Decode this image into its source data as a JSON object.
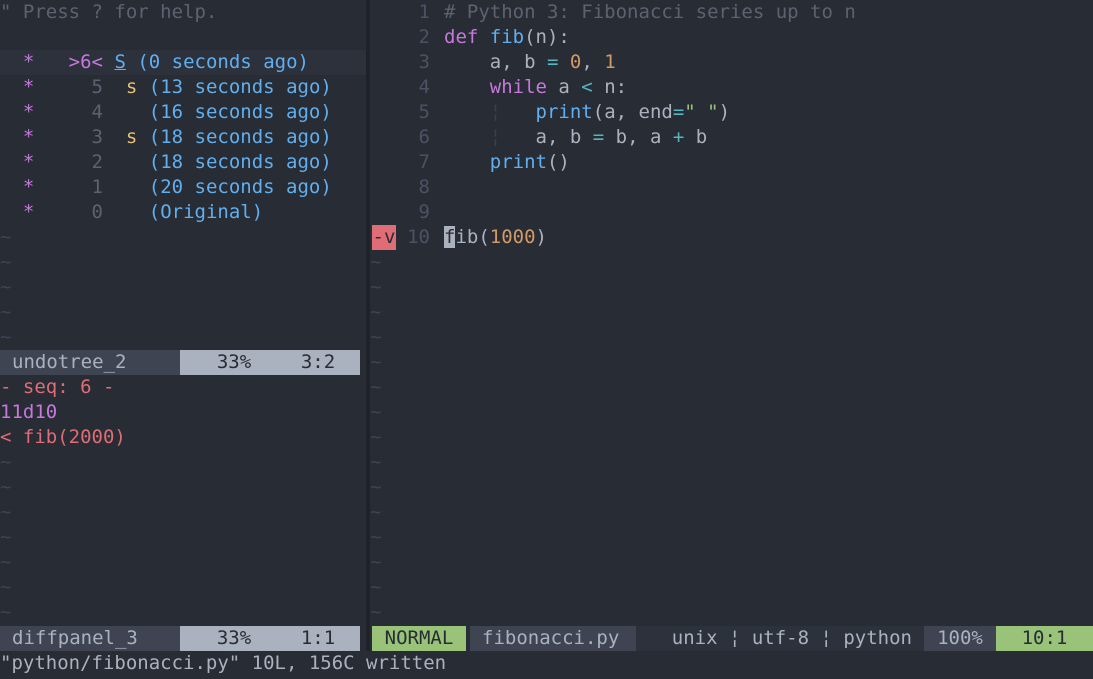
{
  "undotree": {
    "help": "\" Press ? for help.",
    "entries": [
      {
        "star": "*",
        "seq": ">6<",
        "saved": "S",
        "time": "(0 seconds ago)",
        "current": true
      },
      {
        "star": "*",
        "seq": "5",
        "saved": "s",
        "time": "(13 seconds ago)",
        "current": false
      },
      {
        "star": "*",
        "seq": "4",
        "saved": "",
        "time": "(16 seconds ago)",
        "current": false
      },
      {
        "star": "*",
        "seq": "3",
        "saved": "s",
        "time": "(18 seconds ago)",
        "current": false
      },
      {
        "star": "*",
        "seq": "2",
        "saved": "",
        "time": "(18 seconds ago)",
        "current": false
      },
      {
        "star": "*",
        "seq": "1",
        "saved": "",
        "time": "(20 seconds ago)",
        "current": false
      },
      {
        "star": "*",
        "seq": "0",
        "saved": "",
        "time": "(Original)",
        "current": false
      }
    ],
    "tilde": "~",
    "status": {
      "name": "undotree_2",
      "percent": "33%",
      "pos": "3:2"
    }
  },
  "diffpanel": {
    "header": "- seq: 6 -",
    "range": "11d10",
    "removed": "< fib(2000)",
    "status": {
      "name": "diffpanel_3",
      "percent": "33%",
      "pos": "1:1"
    }
  },
  "editor": {
    "line_numbers": [
      "1",
      "2",
      "3",
      "4",
      "5",
      "6",
      "7",
      "8",
      "9",
      "10"
    ],
    "code": {
      "l1": "# Python 3: Fibonacci series up to n",
      "l2_kw": "def",
      "l2_fn": "fib",
      "l2_rest": "(n):",
      "l3_a": "a, b ",
      "l3_eq": "=",
      "l3_zero": "0",
      "l3_comma": ", ",
      "l3_one": "1",
      "l4_kw": "while",
      "l4_a": " a ",
      "l4_lt": "<",
      "l4_rest": " n:",
      "indent_guide": "¦",
      "l5_fn": "print",
      "l5_open": "(a, end",
      "l5_eq": "=",
      "l5_str": "\" \"",
      "l5_close": ")",
      "l6_a": "a, b ",
      "l6_eq": "=",
      "l6_mid": " b, a ",
      "l6_plus": "+",
      "l6_end": " b",
      "l7_fn": "print",
      "l7_rest": "()",
      "l10_cursor": "f",
      "l10_ib": "ib(",
      "l10_num": "1000",
      "l10_close": ")"
    },
    "sign": "-v",
    "tilde": "~",
    "status": {
      "mode": "NORMAL",
      "file": "fibonacci.py",
      "info": "unix ¦ utf-8 ¦ python",
      "percent": "100%",
      "pos": "10:1"
    }
  },
  "cmdline": "\"python/fibonacci.py\" 10L, 156C written",
  "colors": {
    "accent": "#98c379",
    "keyword": "#c678dd",
    "function": "#61afef",
    "number": "#d19a66",
    "removed": "#e06c75"
  }
}
